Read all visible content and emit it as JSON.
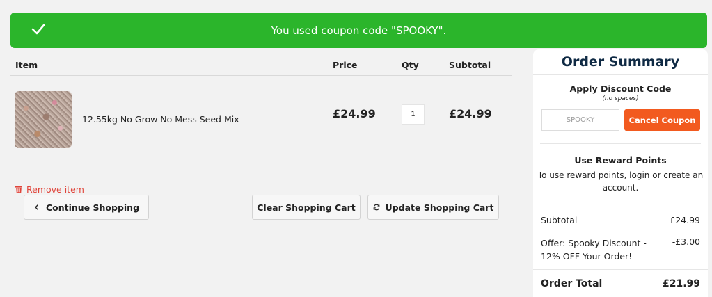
{
  "banner": {
    "message": "You used coupon code \"SPOOKY\".",
    "color": "#2bb52b"
  },
  "cart": {
    "headers": {
      "item": "Item",
      "price": "Price",
      "qty": "Qty",
      "subtotal": "Subtotal"
    },
    "items": [
      {
        "name": "12.55kg No Grow No Mess Seed Mix",
        "price": "£24.99",
        "qty": "1",
        "subtotal": "£24.99",
        "remove_label": "Remove item"
      }
    ],
    "buttons": {
      "continue": "Continue Shopping",
      "clear": "Clear Shopping Cart",
      "update": "Update Shopping Cart"
    }
  },
  "summary": {
    "title": "Order Summary",
    "discount": {
      "title": "Apply Discount Code",
      "hint": "(no spaces)",
      "code_value": "SPOOKY",
      "cancel_label": "Cancel Coupon",
      "accent": "#f25a1f"
    },
    "reward": {
      "title": "Use Reward Points",
      "text": "To use reward points, login or create an account."
    },
    "lines": {
      "subtotal_label": "Subtotal",
      "subtotal_value": "£24.99",
      "offer_label": "Offer: Spooky Discount - 12% OFF Your Order!",
      "offer_value": "-£3.00",
      "total_label": "Order Total",
      "total_value": "£21.99"
    }
  }
}
